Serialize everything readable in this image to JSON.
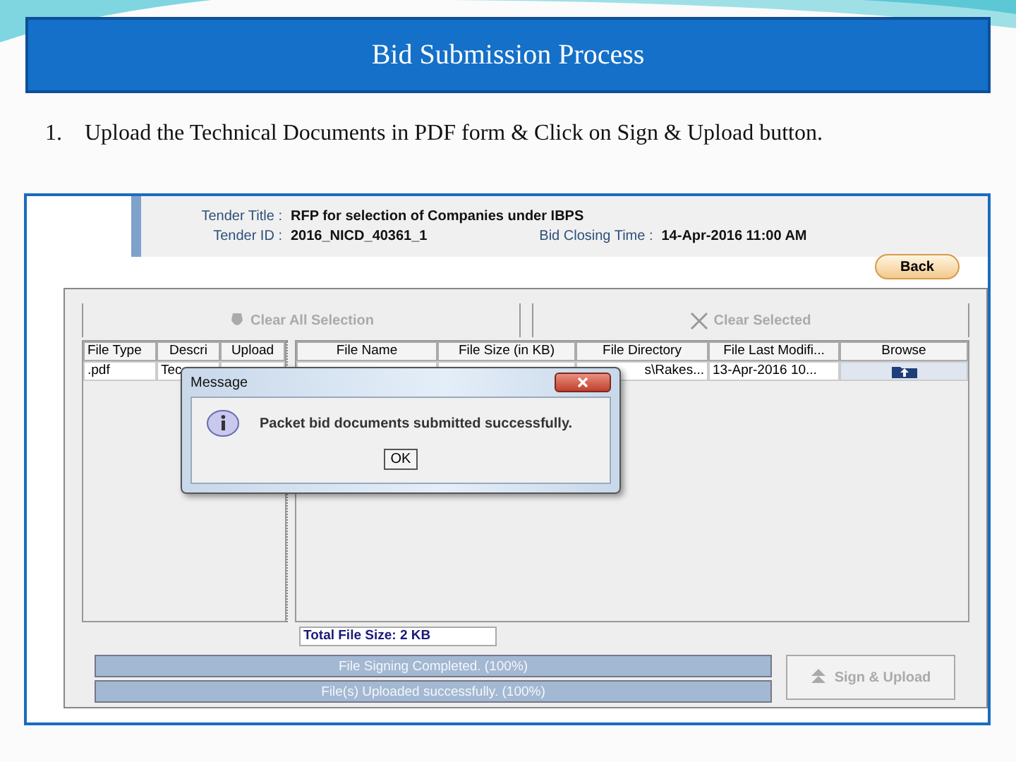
{
  "slide": {
    "title": "Bid Submission Process",
    "steps": [
      {
        "number": "1.",
        "text": "Upload the Technical Documents in PDF form & Click on Sign & Upload button."
      }
    ]
  },
  "header": {
    "rows": [
      [
        {
          "label": "Tender Title :",
          "value": "RFP for selection of Companies under IBPS"
        }
      ],
      [
        {
          "label": "Tender ID :",
          "value": "2016_NICD_40361_1"
        },
        {
          "label": "Bid Closing Time :",
          "value": "14-Apr-2016 11:00 AM"
        }
      ]
    ]
  },
  "back_button": "Back",
  "toolbar": [
    {
      "kind": "clear-all",
      "label": "Clear All Selection",
      "disabled": true
    },
    {
      "kind": "clear",
      "label": "Clear Selected",
      "disabled": true
    }
  ],
  "left_table": {
    "columns": [
      "File Type",
      "Descri",
      "Upload"
    ],
    "rows": [
      {
        "file_type": ".pdf",
        "description": "Tec",
        "selected": false
      }
    ]
  },
  "right_table": {
    "columns": [
      "File Name",
      "File Size (in KB)",
      "File Directory",
      "File Last Modifi...",
      "Browse"
    ],
    "rows": [
      {
        "file_directory": "s\\Rakes...",
        "last_modified": "13-Apr-2016 10...",
        "selected": false
      }
    ]
  },
  "total_file_size": "Total File Size: 2 KB",
  "progress": [
    {
      "label": "File Signing Completed. (100%)",
      "level": 1
    },
    {
      "label": "File(s) Uploaded successfully. (100%)",
      "level": 1
    }
  ],
  "sign_upload_button": {
    "label": "Sign & Upload",
    "disabled": true
  },
  "dialog": {
    "title": "Message",
    "message": "Packet bid documents submitted successfully.",
    "ok": "OK"
  }
}
